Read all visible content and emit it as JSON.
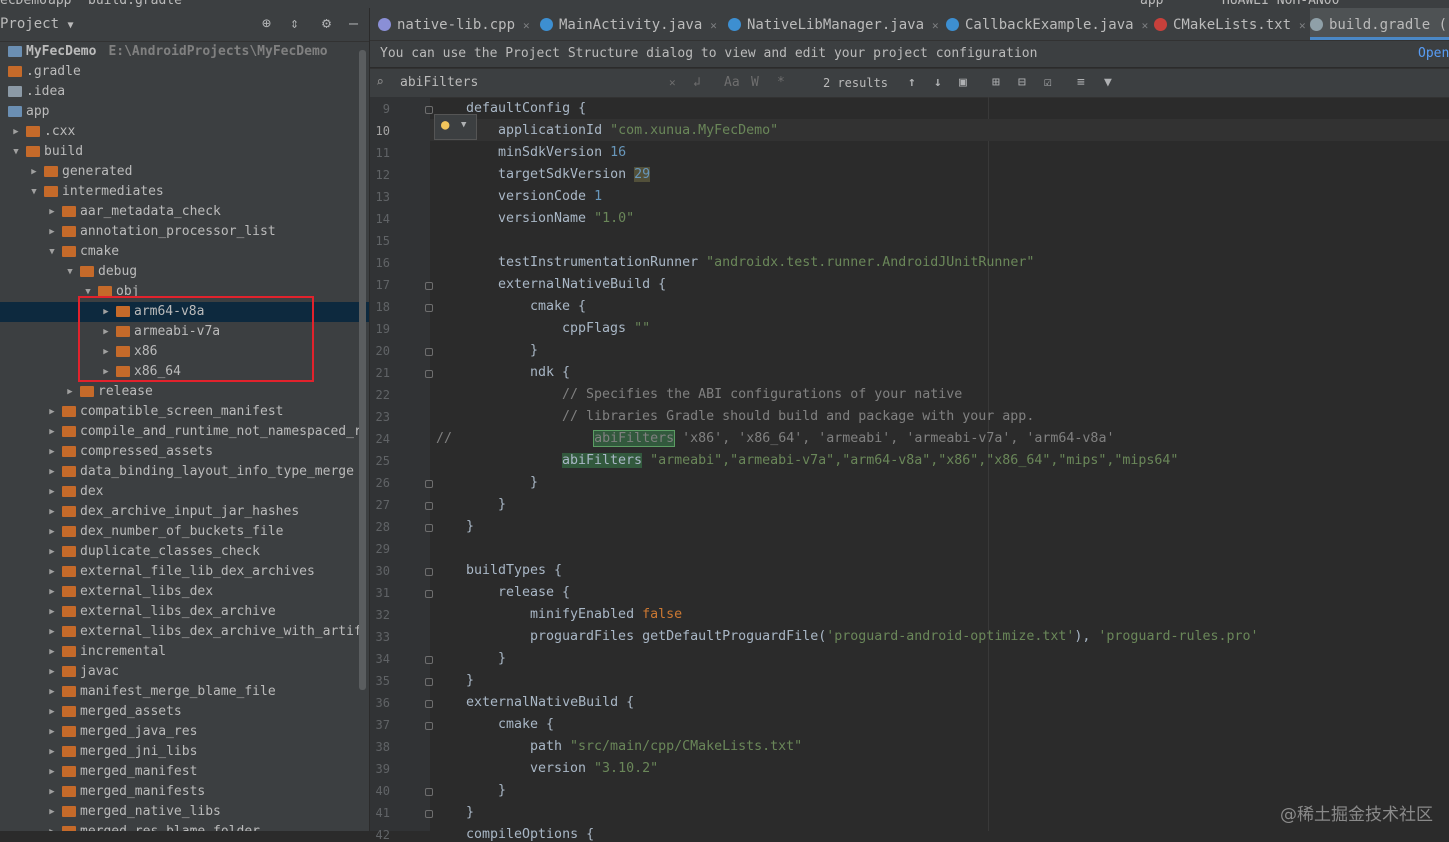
{
  "top_strip": {
    "items": [
      "ecDemo",
      "app",
      "build.gradle",
      "app",
      "HUAWEI NOH-AN00"
    ]
  },
  "project_pane": {
    "title": "Project",
    "tree": [
      {
        "label": "MyFecDemo",
        "path": "E:\\AndroidProjects\\MyFecDemo",
        "depth": 0,
        "state": "none",
        "folder": "blue"
      },
      {
        "label": ".gradle",
        "depth": 0,
        "state": "none",
        "folder": "orange"
      },
      {
        "label": ".idea",
        "depth": 0,
        "state": "none",
        "folder": "grey"
      },
      {
        "label": "app",
        "depth": 0,
        "state": "none",
        "folder": "blue"
      },
      {
        "label": ".cxx",
        "depth": 0,
        "state": "closed",
        "folder": "orange"
      },
      {
        "label": "build",
        "depth": 0,
        "state": "open",
        "folder": "orange"
      },
      {
        "label": "generated",
        "depth": 1,
        "state": "closed",
        "folder": "orange"
      },
      {
        "label": "intermediates",
        "depth": 1,
        "state": "open",
        "folder": "orange"
      },
      {
        "label": "aar_metadata_check",
        "depth": 2,
        "state": "closed",
        "folder": "orange"
      },
      {
        "label": "annotation_processor_list",
        "depth": 2,
        "state": "closed",
        "folder": "orange"
      },
      {
        "label": "cmake",
        "depth": 2,
        "state": "open",
        "folder": "orange"
      },
      {
        "label": "debug",
        "depth": 3,
        "state": "open",
        "folder": "orange"
      },
      {
        "label": "obj",
        "depth": 4,
        "state": "open",
        "folder": "orange"
      },
      {
        "label": "arm64-v8a",
        "depth": 5,
        "state": "closed",
        "folder": "orange",
        "selected": true
      },
      {
        "label": "armeabi-v7a",
        "depth": 5,
        "state": "closed",
        "folder": "orange"
      },
      {
        "label": "x86",
        "depth": 5,
        "state": "closed",
        "folder": "orange"
      },
      {
        "label": "x86_64",
        "depth": 5,
        "state": "closed",
        "folder": "orange"
      },
      {
        "label": "release",
        "depth": 3,
        "state": "closed",
        "folder": "orange"
      },
      {
        "label": "compatible_screen_manifest",
        "depth": 2,
        "state": "closed",
        "folder": "orange"
      },
      {
        "label": "compile_and_runtime_not_namespaced_r",
        "depth": 2,
        "state": "closed",
        "folder": "orange"
      },
      {
        "label": "compressed_assets",
        "depth": 2,
        "state": "closed",
        "folder": "orange"
      },
      {
        "label": "data_binding_layout_info_type_merge",
        "depth": 2,
        "state": "closed",
        "folder": "orange"
      },
      {
        "label": "dex",
        "depth": 2,
        "state": "closed",
        "folder": "orange"
      },
      {
        "label": "dex_archive_input_jar_hashes",
        "depth": 2,
        "state": "closed",
        "folder": "orange"
      },
      {
        "label": "dex_number_of_buckets_file",
        "depth": 2,
        "state": "closed",
        "folder": "orange"
      },
      {
        "label": "duplicate_classes_check",
        "depth": 2,
        "state": "closed",
        "folder": "orange"
      },
      {
        "label": "external_file_lib_dex_archives",
        "depth": 2,
        "state": "closed",
        "folder": "orange"
      },
      {
        "label": "external_libs_dex",
        "depth": 2,
        "state": "closed",
        "folder": "orange"
      },
      {
        "label": "external_libs_dex_archive",
        "depth": 2,
        "state": "closed",
        "folder": "orange"
      },
      {
        "label": "external_libs_dex_archive_with_artif",
        "depth": 2,
        "state": "closed",
        "folder": "orange"
      },
      {
        "label": "incremental",
        "depth": 2,
        "state": "closed",
        "folder": "orange"
      },
      {
        "label": "javac",
        "depth": 2,
        "state": "closed",
        "folder": "orange"
      },
      {
        "label": "manifest_merge_blame_file",
        "depth": 2,
        "state": "closed",
        "folder": "orange"
      },
      {
        "label": "merged_assets",
        "depth": 2,
        "state": "closed",
        "folder": "orange"
      },
      {
        "label": "merged_java_res",
        "depth": 2,
        "state": "closed",
        "folder": "orange"
      },
      {
        "label": "merged_jni_libs",
        "depth": 2,
        "state": "closed",
        "folder": "orange"
      },
      {
        "label": "merged_manifest",
        "depth": 2,
        "state": "closed",
        "folder": "orange"
      },
      {
        "label": "merged_manifests",
        "depth": 2,
        "state": "closed",
        "folder": "orange"
      },
      {
        "label": "merged_native_libs",
        "depth": 2,
        "state": "closed",
        "folder": "orange"
      },
      {
        "label": "merged_res_blame_folder",
        "depth": 2,
        "state": "closed",
        "folder": "orange"
      }
    ]
  },
  "tabs": [
    {
      "label": "native-lib.cpp",
      "icon": "cpp-file-icon",
      "color": "#8a8fd6"
    },
    {
      "label": "MainActivity.java",
      "icon": "java-class-icon",
      "color": "#3d8fd1"
    },
    {
      "label": "NativeLibManager.java",
      "icon": "java-class-icon",
      "color": "#3d8fd1"
    },
    {
      "label": "CallbackExample.java",
      "icon": "java-class-icon",
      "color": "#3d8fd1"
    },
    {
      "label": "CMakeLists.txt",
      "icon": "cmake-file-icon",
      "color": "#c8403b"
    },
    {
      "label": "build.gradle (",
      "icon": "gradle-file-icon",
      "color": "#8fa0a8",
      "active": true
    }
  ],
  "notice": {
    "message": "You can use the Project Structure dialog to view and edit your project configuration",
    "link": "Open"
  },
  "search": {
    "query": "abiFilters",
    "results": "2 results",
    "aa": "Aa",
    "w": "W",
    "regex": "*"
  },
  "code_lines": [
    {
      "n": "9",
      "indent": 1,
      "t": [
        [
          "p",
          "defaultConfig {"
        ]
      ]
    },
    {
      "n": "10",
      "indent": 2,
      "t": [
        [
          "p",
          "applicationId "
        ],
        [
          "s",
          "\"com.xunua.MyFecDemo\""
        ]
      ]
    },
    {
      "n": "11",
      "indent": 2,
      "t": [
        [
          "p",
          "minSdkVersion "
        ],
        [
          "n",
          "16"
        ]
      ]
    },
    {
      "n": "12",
      "indent": 2,
      "t": [
        [
          "p",
          "targetSdkVersion "
        ],
        [
          "nh",
          "29"
        ]
      ]
    },
    {
      "n": "13",
      "indent": 2,
      "t": [
        [
          "p",
          "versionCode "
        ],
        [
          "n",
          "1"
        ]
      ]
    },
    {
      "n": "14",
      "indent": 2,
      "t": [
        [
          "p",
          "versionName "
        ],
        [
          "s",
          "\"1.0\""
        ]
      ]
    },
    {
      "n": "15",
      "indent": 0,
      "t": []
    },
    {
      "n": "16",
      "indent": 2,
      "t": [
        [
          "p",
          "testInstrumentationRunner "
        ],
        [
          "s",
          "\"androidx.test.runner.AndroidJUnitRunner\""
        ]
      ]
    },
    {
      "n": "17",
      "indent": 2,
      "t": [
        [
          "p",
          "externalNativeBuild {"
        ]
      ]
    },
    {
      "n": "18",
      "indent": 3,
      "t": [
        [
          "p",
          "cmake {"
        ]
      ]
    },
    {
      "n": "19",
      "indent": 4,
      "t": [
        [
          "p",
          "cppFlags "
        ],
        [
          "s",
          "\"\""
        ]
      ]
    },
    {
      "n": "20",
      "indent": 3,
      "t": [
        [
          "p",
          "}"
        ]
      ]
    },
    {
      "n": "21",
      "indent": 3,
      "t": [
        [
          "p",
          "ndk {"
        ]
      ]
    },
    {
      "n": "22",
      "indent": 4,
      "t": [
        [
          "c",
          "// Specifies the ABI configurations of your native"
        ]
      ]
    },
    {
      "n": "23",
      "indent": 4,
      "t": [
        [
          "c",
          "// libraries Gradle should build and package with your app."
        ]
      ]
    },
    {
      "n": "24",
      "indent": 0,
      "prefix": "//",
      "t": [
        [
          "sp",
          "                "
        ],
        [
          "hb",
          "abiFilters"
        ],
        [
          "c",
          " 'x86', 'x86_64', 'armeabi', 'armeabi-v7a', 'arm64-v8a'"
        ]
      ]
    },
    {
      "n": "25",
      "indent": 4,
      "t": [
        [
          "h",
          "abiFilters"
        ],
        [
          "s",
          " \"armeabi\",\"armeabi-v7a\",\"arm64-v8a\",\"x86\",\"x86_64\",\"mips\",\"mips64\""
        ]
      ]
    },
    {
      "n": "26",
      "indent": 3,
      "t": [
        [
          "p",
          "}"
        ]
      ]
    },
    {
      "n": "27",
      "indent": 2,
      "t": [
        [
          "p",
          "}"
        ]
      ]
    },
    {
      "n": "28",
      "indent": 1,
      "t": [
        [
          "p",
          "}"
        ]
      ]
    },
    {
      "n": "29",
      "indent": 0,
      "t": []
    },
    {
      "n": "30",
      "indent": 1,
      "t": [
        [
          "p",
          "buildTypes {"
        ]
      ]
    },
    {
      "n": "31",
      "indent": 2,
      "t": [
        [
          "p",
          "release {"
        ]
      ]
    },
    {
      "n": "32",
      "indent": 3,
      "t": [
        [
          "p",
          "minifyEnabled "
        ],
        [
          "k",
          "false"
        ]
      ]
    },
    {
      "n": "33",
      "indent": 3,
      "t": [
        [
          "p",
          "proguardFiles getDefaultProguardFile("
        ],
        [
          "s",
          "'proguard-android-optimize.txt'"
        ],
        [
          "p",
          "), "
        ],
        [
          "s",
          "'proguard-rules.pro'"
        ]
      ]
    },
    {
      "n": "34",
      "indent": 2,
      "t": [
        [
          "p",
          "}"
        ]
      ]
    },
    {
      "n": "35",
      "indent": 1,
      "t": [
        [
          "p",
          "}"
        ]
      ]
    },
    {
      "n": "36",
      "indent": 1,
      "t": [
        [
          "p",
          "externalNativeBuild {"
        ]
      ]
    },
    {
      "n": "37",
      "indent": 2,
      "t": [
        [
          "p",
          "cmake {"
        ]
      ]
    },
    {
      "n": "38",
      "indent": 3,
      "t": [
        [
          "p",
          "path "
        ],
        [
          "s",
          "\"src/main/cpp/CMakeLists.txt\""
        ]
      ]
    },
    {
      "n": "39",
      "indent": 3,
      "t": [
        [
          "p",
          "version "
        ],
        [
          "s",
          "\"3.10.2\""
        ]
      ]
    },
    {
      "n": "40",
      "indent": 2,
      "t": [
        [
          "p",
          "}"
        ]
      ]
    },
    {
      "n": "41",
      "indent": 1,
      "t": [
        [
          "p",
          "}"
        ]
      ]
    },
    {
      "n": "42",
      "indent": 1,
      "t": [
        [
          "p",
          "compileOptions {"
        ]
      ]
    }
  ],
  "watermark": "@稀土掘金技术社区"
}
